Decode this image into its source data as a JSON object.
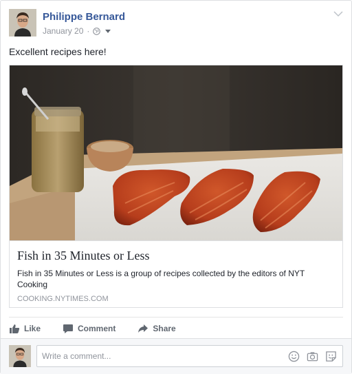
{
  "post": {
    "author": "Philippe Bernard",
    "date": "January 20",
    "separator": "·",
    "privacy_icon": "globe-icon",
    "text": "Excellent recipes here!"
  },
  "link_preview": {
    "title": "Fish in 35 Minutes or Less",
    "description": "Fish in 35 Minutes or Less is a group of recipes collected by the editors of NYT Cooking",
    "domain": "COOKING.NYTIMES.COM"
  },
  "actions": {
    "like": "Like",
    "comment": "Comment",
    "share": "Share"
  },
  "comment_box": {
    "placeholder": "Write a comment...",
    "icons": [
      "emoji-icon",
      "camera-icon",
      "sticker-icon"
    ]
  },
  "colors": {
    "author_link": "#365899",
    "muted_text": "#90949c",
    "border": "#dddfe2",
    "action_text": "#606770"
  }
}
